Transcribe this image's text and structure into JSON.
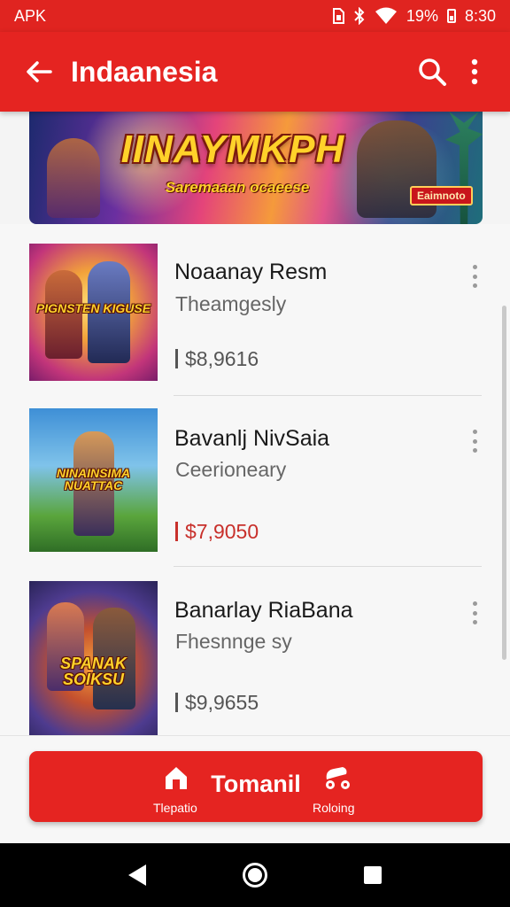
{
  "status_bar": {
    "left_label": "APK",
    "battery": "19%",
    "time": "8:30"
  },
  "app_bar": {
    "title": "Indaanesia",
    "back_icon": "arrow-left-icon",
    "search_icon": "search-icon",
    "menu_icon": "more-vert-icon"
  },
  "banner": {
    "title": "IINAYMKPH",
    "subtitle": "Saremaaan ocaeese",
    "tag": "Eaimnoto"
  },
  "list": {
    "items": [
      {
        "name": "Noaanay Resm",
        "subtitle": "Theamgesly",
        "price": "$8,9616",
        "price_color": "#555555",
        "thumb_text": "PIGNSTEN KIGUSE",
        "colors": [
          "#f2a23a",
          "#b0236d"
        ]
      },
      {
        "name": "Bavanlj NivSaia",
        "subtitle": "Ceerioneary",
        "price": "$7,9050",
        "price_color": "#c8302b",
        "thumb_text": "NINAINSIMA NUATTAC",
        "colors": [
          "#4a9ad8",
          "#53a33c"
        ]
      },
      {
        "name": "Banarlay RiaBana",
        "subtitle": "Fhesnnge sy",
        "price": "$9,9655",
        "price_color": "#555555",
        "thumb_text": "SPANAK SOIKSU",
        "colors": [
          "#5e47a8",
          "#e07a2e"
        ]
      }
    ]
  },
  "bottom_button": {
    "label": "Tomanil",
    "left_caption": "Tlepatio",
    "right_caption": "Roloing",
    "left_icon": "home-icon",
    "right_icon": "delivery-icon"
  },
  "nav_bar": {
    "back_icon": "nav-back-icon",
    "home_icon": "nav-home-icon",
    "recents_icon": "nav-recents-icon"
  }
}
